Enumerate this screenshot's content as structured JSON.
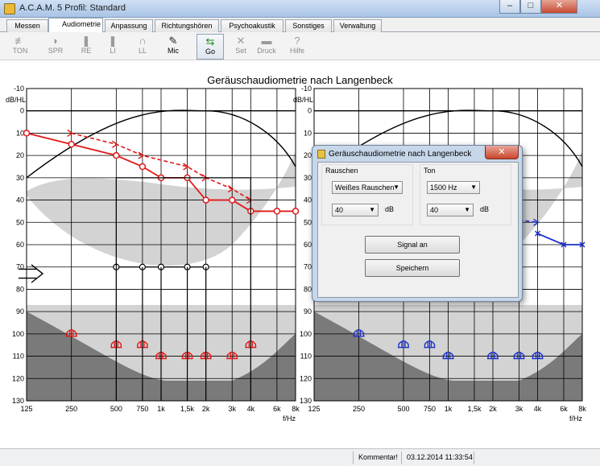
{
  "window": {
    "title": "A.C.A.M. 5  Profil: Standard",
    "btn_min": "–",
    "btn_max": "□",
    "btn_close": "✕"
  },
  "tabs": [
    {
      "label": "Messen"
    },
    {
      "label": "Audiometrie"
    },
    {
      "label": "Anpassung"
    },
    {
      "label": "Richtungshören"
    },
    {
      "label": "Psychoakustik"
    },
    {
      "label": "Sonstiges"
    },
    {
      "label": "Verwaltung"
    }
  ],
  "help_icon": "undo-arrow-icon",
  "toolbar": [
    {
      "label": "TON",
      "icon": "≢"
    },
    {
      "label": "SPR",
      "icon": "◗"
    },
    {
      "label": "RE",
      "icon": "❚"
    },
    {
      "label": "LI",
      "icon": "❚"
    },
    {
      "label": "LL",
      "icon": "∩"
    },
    {
      "label": "Mic",
      "icon": "✎"
    },
    {
      "label": "Go",
      "icon": "⇆"
    },
    {
      "label": "Set",
      "icon": "✕"
    },
    {
      "label": "Druck",
      "icon": "▬"
    },
    {
      "label": "Hilfe",
      "icon": "?"
    }
  ],
  "chart_title": "Geräuschaudiometrie nach Langenbeck",
  "chart_data": [
    {
      "type": "line",
      "side": "right-ear",
      "ylabel": "dB/HL",
      "xlabel": "f/Hz",
      "ylim": [
        -10,
        130
      ],
      "yticks": [
        "-10",
        "0",
        "10",
        "20",
        "30",
        "40",
        "50",
        "60",
        "70",
        "80",
        "90",
        "100",
        "110",
        "120",
        "130"
      ],
      "xticks": [
        "125",
        "250",
        "500",
        "750",
        "1k",
        "1,5k",
        "2k",
        "3k",
        "4k",
        "6k",
        "8k"
      ],
      "series": [
        {
          "style": "threshold",
          "points": [
            [
              125,
              10
            ],
            [
              250,
              15
            ],
            [
              500,
              20
            ],
            [
              750,
              25
            ],
            [
              1000,
              30
            ],
            [
              1500,
              30
            ],
            [
              2000,
              40
            ],
            [
              3000,
              40
            ],
            [
              4000,
              45
            ],
            [
              6000,
              45
            ],
            [
              8000,
              45
            ]
          ]
        },
        {
          "style": "langenbeck-dashed",
          "points": [
            [
              250,
              10
            ],
            [
              500,
              15
            ],
            [
              750,
              20
            ],
            [
              1500,
              25
            ],
            [
              2000,
              30
            ],
            [
              3000,
              35
            ],
            [
              4000,
              40
            ]
          ]
        },
        {
          "style": "noise-level-circles",
          "points": [
            [
              500,
              70
            ],
            [
              750,
              70
            ],
            [
              1000,
              70
            ],
            [
              1500,
              70
            ],
            [
              2000,
              70
            ]
          ]
        },
        {
          "style": "ucl-markers",
          "points": [
            [
              250,
              100
            ],
            [
              500,
              105
            ],
            [
              750,
              105
            ],
            [
              1000,
              110
            ],
            [
              1500,
              110
            ],
            [
              2000,
              110
            ],
            [
              3000,
              110
            ],
            [
              4000,
              105
            ]
          ]
        }
      ]
    },
    {
      "type": "line",
      "side": "left-ear",
      "ylabel": "dB/HL",
      "xlabel": "f/Hz",
      "ylim": [
        -10,
        130
      ],
      "yticks": [
        "-10",
        "0",
        "10",
        "20",
        "30",
        "40",
        "50",
        "60",
        "70",
        "80",
        "90",
        "100",
        "110",
        "120",
        "130"
      ],
      "xticks": [
        "125",
        "250",
        "500",
        "750",
        "1k",
        "1,5k",
        "2k",
        "3k",
        "4k",
        "6k",
        "8k"
      ],
      "series": [
        {
          "style": "threshold",
          "points": [
            [
              4000,
              55
            ],
            [
              6000,
              60
            ],
            [
              8000,
              60
            ]
          ]
        },
        {
          "style": "langenbeck-dashed",
          "points": [
            [
              3000,
              49
            ],
            [
              4000,
              50
            ]
          ]
        },
        {
          "style": "ucl-markers",
          "points": [
            [
              250,
              100
            ],
            [
              500,
              105
            ],
            [
              750,
              105
            ],
            [
              1000,
              110
            ],
            [
              2000,
              110
            ],
            [
              3000,
              110
            ],
            [
              4000,
              110
            ]
          ]
        }
      ]
    }
  ],
  "dialog": {
    "title": "Geräuschaudiometrie nach Langenbeck",
    "close": "✕",
    "group_noise": {
      "label": "Rauschen",
      "type": "Weißes Rauschen",
      "level": "40",
      "unit": "dB"
    },
    "group_tone": {
      "label": "Ton",
      "freq": "1500 Hz",
      "level": "40",
      "unit": "dB"
    },
    "signal_button": "Signal an",
    "save_button": "Speichern"
  },
  "status": {
    "comment": "Kommentar!",
    "datetime": "03.12.2014 11:33:54"
  },
  "colors": {
    "right": "#e01818",
    "left": "#1a2fc8",
    "band_light": "#d3d3d3",
    "band_dark": "#7a7a7a"
  }
}
